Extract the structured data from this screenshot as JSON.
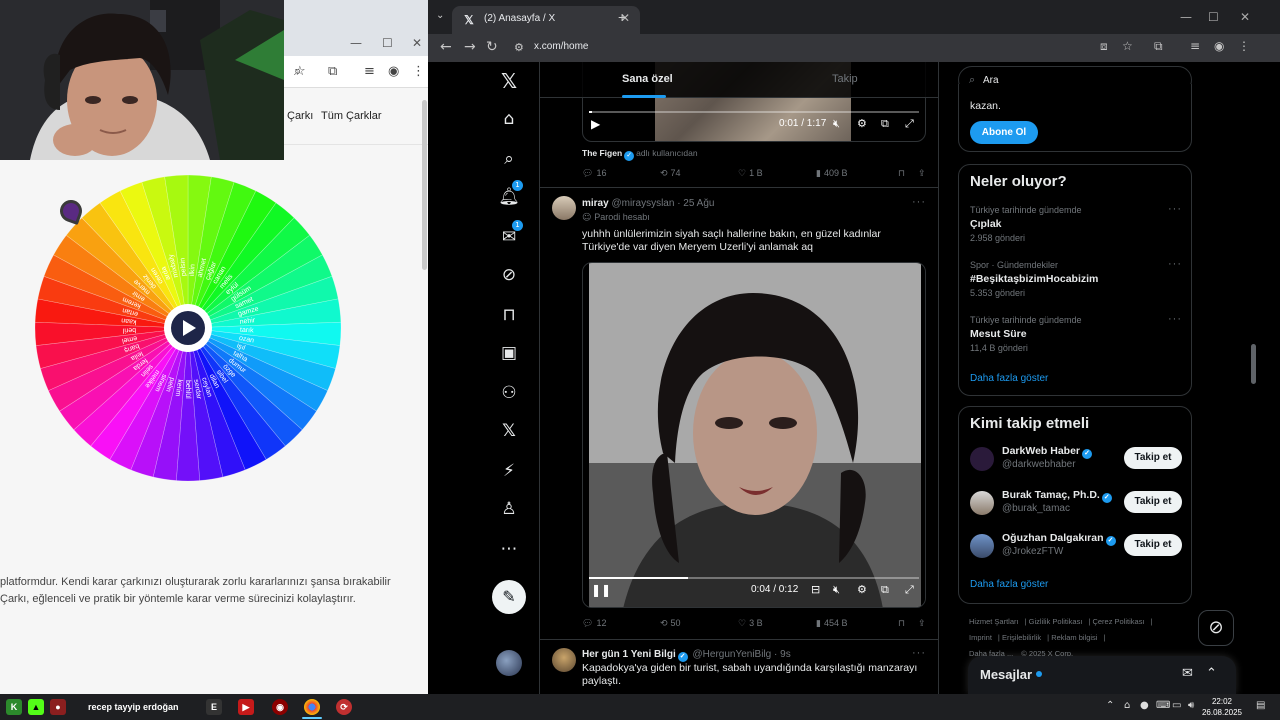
{
  "left_window": {
    "nav": {
      "wheel_link": "Çarkı",
      "all_wheels": "Tüm Çarklar"
    },
    "wheel_names": [
      "ilkin",
      "ahmet",
      "çağlar",
      "canan",
      "melis",
      "eylül",
      "gülsüm",
      "samet",
      "gamze",
      "nehir",
      "tarık",
      "ozan",
      "işıl",
      "talha",
      "dumur",
      "özge",
      "sibel",
      "dilan",
      "ceylan",
      "serdar",
      "behlül",
      "kerim",
      "pelin",
      "sinem",
      "melike",
      "selin",
      "ferda",
      "leila",
      "barış",
      "emel",
      "beril",
      "kaan",
      "ertan",
      "kerem",
      "emir",
      "merve",
      "deniz",
      "ceren",
      "arda",
      "mixbaly",
      "pelsin"
    ],
    "description_line1": "platformdur. Kendi karar çarkınızı oluşturarak zorlu kararlarınızı şansa bırakabilir",
    "description_line2": "Çarkı, eğlenceli ve pratik bir yöntemle karar verme sürecinizi kolaylaştırır."
  },
  "browser": {
    "tab_title": "(2) Anasayfa / X",
    "url": "x.com/home",
    "icons": {
      "back": "arrow-left-icon",
      "forward": "arrow-right-icon",
      "reload": "reload-icon",
      "site_info": "site-info-icon",
      "extensions": "puzzle-icon",
      "bookmark": "star-icon",
      "profile": "profile-icon",
      "menu": "kebab-menu-icon"
    }
  },
  "x": {
    "tabs": {
      "for_you": "Sana özel",
      "following": "Takip"
    },
    "nav_badges": {
      "notifications": "1",
      "messages": "1"
    },
    "search": {
      "value": "Ara"
    },
    "posts": [
      {
        "video_time": "0:01 / 1:17",
        "video_progress": 0.01,
        "attribution_name": "The Figen",
        "attribution_suffix": "adlı kullanıcıdan",
        "replies": "16",
        "reposts": "74",
        "likes": "1 B",
        "views": "409 B"
      },
      {
        "name": "miray",
        "handle": "@miraysyslan",
        "date": "· 25 Ağu",
        "label": "Parodi hesabı",
        "text": "yuhhh ünlülerimizin siyah saçlı hallerine bakın, en güzel kadınlar Türkiye'de var diyen Meryem Uzerli'yi anlamak aq",
        "video_time": "0:04 / 0:12",
        "video_progress": 0.3,
        "replies": "12",
        "reposts": "50",
        "likes": "3 B",
        "views": "454 B"
      },
      {
        "name": "Her gün 1 Yeni Bilgi",
        "handle": "@HergunYeniBilg",
        "date": "· 9s",
        "text": "Kapadokya'ya giden bir turist, sabah uyandığında karşılaştığı manzarayı paylaştı."
      }
    ],
    "premium_card": {
      "text": "kazan.",
      "button": "Abone Ol"
    },
    "trends": {
      "title": "Neler oluyor?",
      "items": [
        {
          "category": "Türkiye tarihinde gündemde",
          "title": "Çıplak",
          "count": "2.958 gönderi"
        },
        {
          "category": "Spor · Gündemdekiler",
          "title": "#BeşiktaşbizimHocabizim",
          "count": "5.353 gönderi"
        },
        {
          "category": "Türkiye tarihinde gündemde",
          "title": "Mesut Süre",
          "count": "11,4 B gönderi"
        }
      ],
      "show_more": "Daha fazla göster"
    },
    "who_to_follow": {
      "title": "Kimi takip etmeli",
      "items": [
        {
          "name": "DarkWeb Haber",
          "handle": "@darkwebhaber",
          "button": "Takip et"
        },
        {
          "name": "Burak Tamaç, Ph.D.",
          "handle": "@burak_tamac",
          "button": "Takip et"
        },
        {
          "name": "Oğuzhan Dalgakıran",
          "handle": "@JrokezFTW",
          "button": "Takip et"
        }
      ],
      "show_more": "Daha fazla göster"
    },
    "footer": {
      "links": [
        "Hizmet Şartları",
        "Gizlilik Politikası",
        "Çerez Politikası",
        "Imprint",
        "Erişilebilirlik",
        "Reklam bilgisi",
        "Daha fazla ..."
      ],
      "copyright": "© 2025 X Corp."
    },
    "messages": {
      "title": "Mesajlar"
    }
  },
  "taskbar": {
    "stream_title": "recep tayyip erdoğan",
    "time": "22:02",
    "date": "26.08.2025"
  },
  "colors": {
    "x_blue": "#1d9bf0",
    "bg": "#000000",
    "text": "#e7e9ea",
    "muted": "#71767b"
  }
}
